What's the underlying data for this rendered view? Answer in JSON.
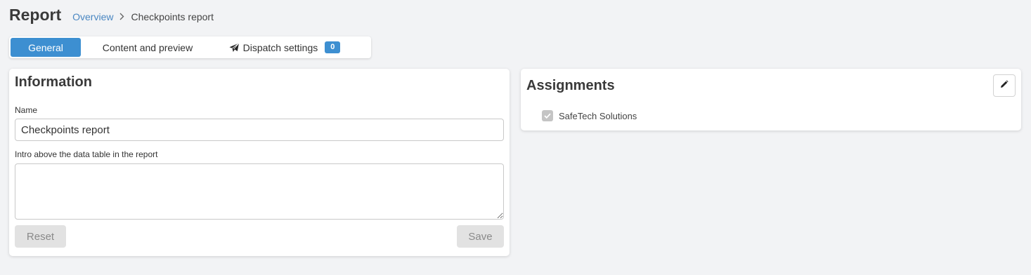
{
  "header": {
    "title": "Report",
    "breadcrumb": {
      "link": "Overview",
      "separator": ">",
      "current": "Checkpoints report"
    }
  },
  "tabs": [
    {
      "label": "General",
      "active": true
    },
    {
      "label": "Content and preview",
      "active": false
    },
    {
      "label": "Dispatch settings",
      "active": false,
      "icon": "paper-plane-icon",
      "badge": "0"
    }
  ],
  "information": {
    "title": "Information",
    "name_label": "Name",
    "name_value": "Checkpoints report",
    "intro_label": "Intro above the data table in the report",
    "intro_value": "",
    "reset_label": "Reset",
    "save_label": "Save"
  },
  "assignments": {
    "title": "Assignments",
    "edit_icon": "pencil-icon",
    "items": [
      {
        "label": "SafeTech Solutions",
        "checked": true,
        "disabled": true
      }
    ]
  },
  "colors": {
    "accent": "#3d8fd1",
    "link": "#4a87c2",
    "background": "#f2f3f5"
  }
}
